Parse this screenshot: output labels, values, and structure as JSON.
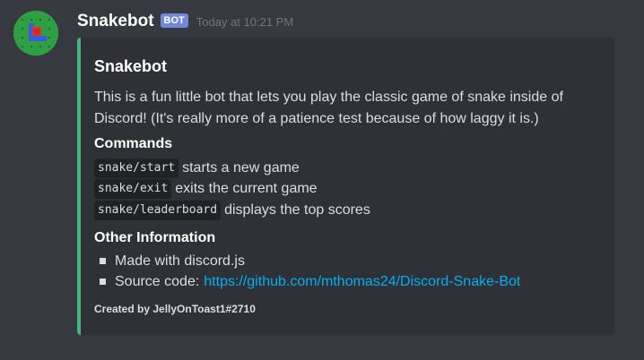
{
  "message": {
    "username": "Snakebot",
    "bot_tag": "BOT",
    "timestamp": "Today at 10:21 PM",
    "avatar_icon": "snake-game-avatar-icon"
  },
  "embed": {
    "accent_color": "#43b581",
    "title": "Snakebot",
    "description": "This is a fun little bot that lets you play the classic game of snake inside of Discord! (It's really more of a patience test because of how laggy it is.)",
    "commands_heading": "Commands",
    "commands": [
      {
        "code": "snake/start",
        "desc": "starts a new game"
      },
      {
        "code": "snake/exit",
        "desc": "exits the current game"
      },
      {
        "code": "snake/leaderboard",
        "desc": "displays the top scores"
      }
    ],
    "other_heading": "Other Information",
    "other_items": [
      {
        "text": "Made with discord.js"
      },
      {
        "text": "Source code:",
        "link": "https://github.com/mthomas24/Discord-Snake-Bot"
      }
    ],
    "footer": "Created by JellyOnToast1#2710"
  },
  "colors": {
    "background": "#36393f",
    "embed_background": "#2f3136",
    "bot_tag": "#7289da",
    "link": "#00b0f4"
  }
}
